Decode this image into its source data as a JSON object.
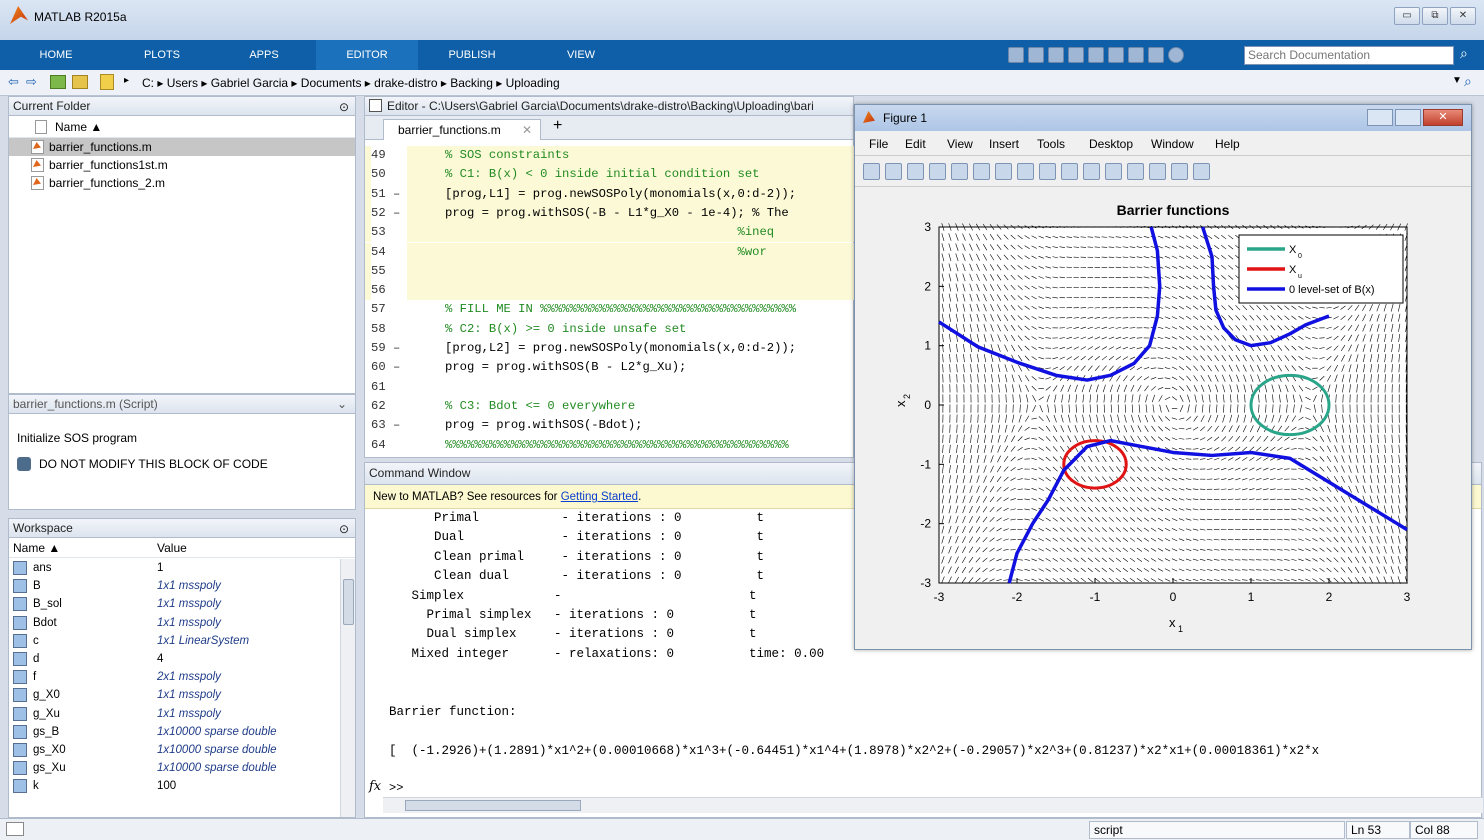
{
  "window": {
    "title": "MATLAB R2015a",
    "controls": [
      "▭",
      "⧉",
      "✕"
    ]
  },
  "ribbon": {
    "tabs": [
      "HOME",
      "PLOTS",
      "APPS",
      "EDITOR",
      "PUBLISH",
      "VIEW"
    ],
    "active_tab": "EDITOR",
    "search_placeholder": "Search Documentation"
  },
  "address": {
    "path": "C: ▸ Users ▸ Gabriel Garcia ▸ Documents ▸ drake-distro ▸ Backing ▸ Uploading"
  },
  "current_folder": {
    "title": "Current Folder",
    "column": "Name ▲",
    "files": [
      "barrier_functions.m",
      "barrier_functions1st.m",
      "barrier_functions_2.m"
    ],
    "selected": "barrier_functions.m"
  },
  "details": {
    "title": "barrier_functions.m (Script)",
    "line1": "Initialize SOS program",
    "line2": "DO NOT MODIFY THIS BLOCK OF CODE"
  },
  "workspace": {
    "title": "Workspace",
    "col_name": "Name ▲",
    "col_value": "Value",
    "vars": [
      {
        "name": "ans",
        "value": "1",
        "plain": true
      },
      {
        "name": "B",
        "value": "1x1 msspoly",
        "plain": false
      },
      {
        "name": "B_sol",
        "value": "1x1 msspoly",
        "plain": false
      },
      {
        "name": "Bdot",
        "value": "1x1 msspoly",
        "plain": false
      },
      {
        "name": "c",
        "value": "1x1 LinearSystem",
        "plain": false
      },
      {
        "name": "d",
        "value": "4",
        "plain": true
      },
      {
        "name": "f",
        "value": "2x1 msspoly",
        "plain": false
      },
      {
        "name": "g_X0",
        "value": "1x1 msspoly",
        "plain": false
      },
      {
        "name": "g_Xu",
        "value": "1x1 msspoly",
        "plain": false
      },
      {
        "name": "gs_B",
        "value": "1x10000 sparse double",
        "plain": false
      },
      {
        "name": "gs_X0",
        "value": "1x10000 sparse double",
        "plain": false
      },
      {
        "name": "gs_Xu",
        "value": "1x10000 sparse double",
        "plain": false
      },
      {
        "name": "k",
        "value": "100",
        "plain": true
      }
    ]
  },
  "editor": {
    "title": "Editor - C:\\Users\\Gabriel Garcia\\Documents\\drake-distro\\Backing\\Uploading\\bari",
    "tab": "barrier_functions.m",
    "lines": [
      {
        "n": "49",
        "code": "% SOS constraints",
        "comment": true,
        "hl": true
      },
      {
        "n": "50",
        "code": "% C1: B(x) < 0 inside initial condition set",
        "comment": true,
        "hl": true
      },
      {
        "n": "51 –",
        "code": "[prog,L1] = prog.newSOSPoly(monomials(x,0:d-2));",
        "comment": false,
        "hl": true
      },
      {
        "n": "52 –",
        "code": "prog = prog.withSOS(-B - L1*g_X0 - 1e-4); % The",
        "comment": false,
        "hl": true
      },
      {
        "n": "53",
        "code": "                                        %ineq",
        "comment": true,
        "hl": true
      },
      {
        "n": "54",
        "code": "                                        %wor",
        "comment": true,
        "hl": true
      },
      {
        "n": "55",
        "code": "",
        "comment": false,
        "hl": true
      },
      {
        "n": "56",
        "code": "",
        "comment": false,
        "hl": true
      },
      {
        "n": "57",
        "code": "% FILL ME IN %%%%%%%%%%%%%%%%%%%%%%%%%%%%%%%%%%%",
        "comment": true,
        "hl": false
      },
      {
        "n": "58",
        "code": "% C2: B(x) >= 0 inside unsafe set",
        "comment": true,
        "hl": false
      },
      {
        "n": "59 –",
        "code": "[prog,L2] = prog.newSOSPoly(monomials(x,0:d-2));",
        "comment": false,
        "hl": false
      },
      {
        "n": "60 –",
        "code": "prog = prog.withSOS(B - L2*g_Xu);",
        "comment": false,
        "hl": false
      },
      {
        "n": "61",
        "code": "",
        "comment": false,
        "hl": false
      },
      {
        "n": "62",
        "code": "% C3: Bdot <= 0 everywhere",
        "comment": true,
        "hl": false
      },
      {
        "n": "63 –",
        "code": "prog = prog.withSOS(-Bdot);",
        "comment": false,
        "hl": false
      },
      {
        "n": "64",
        "code": "%%%%%%%%%%%%%%%%%%%%%%%%%%%%%%%%%%%%%%%%%%%%%%%",
        "comment": true,
        "hl": false
      }
    ]
  },
  "command": {
    "title": "Command Window",
    "banner": "New to MATLAB? See resources for ",
    "banner_link": "Getting Started",
    "banner_end": ".",
    "lines": [
      "      Primal           - iterations : 0          t",
      "      Dual             - iterations : 0          t",
      "      Clean primal     - iterations : 0          t",
      "      Clean dual       - iterations : 0          t",
      "   Simplex            -                         t",
      "     Primal simplex   - iterations : 0          t",
      "     Dual simplex     - iterations : 0          t",
      "   Mixed integer      - relaxations: 0          time: 0.00",
      "",
      "",
      "Barrier function:",
      "",
      "[  (-1.2926)+(1.2891)*x1^2+(0.00010668)*x1^3+(-0.64451)*x1^4+(1.8978)*x2^2+(-0.29057)*x2^3+(0.81237)*x2*x1+(0.00018361)*x2*x"
    ],
    "prompt": ">>",
    "fx": "fx"
  },
  "figure": {
    "title": "Figure 1",
    "menu": [
      "File",
      "Edit",
      "View",
      "Insert",
      "Tools",
      "Desktop",
      "Window",
      "Help"
    ]
  },
  "chart_data": {
    "type": "line",
    "title": "Barrier functions",
    "xlabel": "x",
    "xlabel_sub": "1",
    "ylabel": "x",
    "ylabel_sub": "2",
    "xlim": [
      -3,
      3
    ],
    "ylim": [
      -3,
      3
    ],
    "xticks": [
      "-3",
      "-2",
      "-1",
      "0",
      "1",
      "2",
      "3"
    ],
    "yticks": [
      "3",
      "2",
      "1",
      "0",
      "-1",
      "-2",
      "-3"
    ],
    "legend_position": "top-right",
    "legend": [
      {
        "label": "X",
        "sub": "0",
        "color": "#2aa58a"
      },
      {
        "label": "X",
        "sub": "u",
        "color": "#e01414"
      },
      {
        "label": "0 level-set of B(x)",
        "sub": "",
        "color": "#1010e0"
      }
    ],
    "x0_circle": {
      "cx": 1.5,
      "cy": 0,
      "r": 0.5
    },
    "xu_circle": {
      "cx": -1,
      "cy": -1,
      "r": 0.4
    },
    "level_set_branches": [
      {
        "name": "upper",
        "x": [
          -3,
          -2.5,
          -2,
          -1.5,
          -1.1,
          -0.8,
          -0.5,
          -0.3,
          -0.2,
          -0.17,
          -0.2,
          -0.28
        ],
        "y": [
          1.4,
          0.98,
          0.72,
          0.5,
          0.42,
          0.5,
          0.7,
          1.0,
          1.5,
          2.0,
          2.6,
          3.0
        ]
      },
      {
        "name": "lower-upper-right",
        "x": [
          0.38,
          0.5,
          0.52,
          0.55,
          0.65,
          0.8,
          1.0,
          1.25,
          1.5,
          1.7,
          2.0
        ],
        "y": [
          3.0,
          2.5,
          2.0,
          1.6,
          1.3,
          1.1,
          1.0,
          1.05,
          1.2,
          1.35,
          1.5
        ]
      },
      {
        "name": "lower",
        "x": [
          -2.1,
          -2.0,
          -1.8,
          -1.6,
          -1.4,
          -1.1,
          -0.8,
          -0.4,
          0.0,
          0.5,
          1.0,
          1.5,
          2.0,
          2.5,
          3.0
        ],
        "y": [
          -3.0,
          -2.5,
          -2.0,
          -1.6,
          -1.1,
          -0.7,
          -0.6,
          -0.7,
          -0.8,
          -0.85,
          -0.8,
          -0.9,
          -1.3,
          -1.7,
          -2.1
        ]
      }
    ]
  },
  "status": {
    "mode": "script",
    "ln": "Ln 53",
    "col": "Col 88"
  }
}
